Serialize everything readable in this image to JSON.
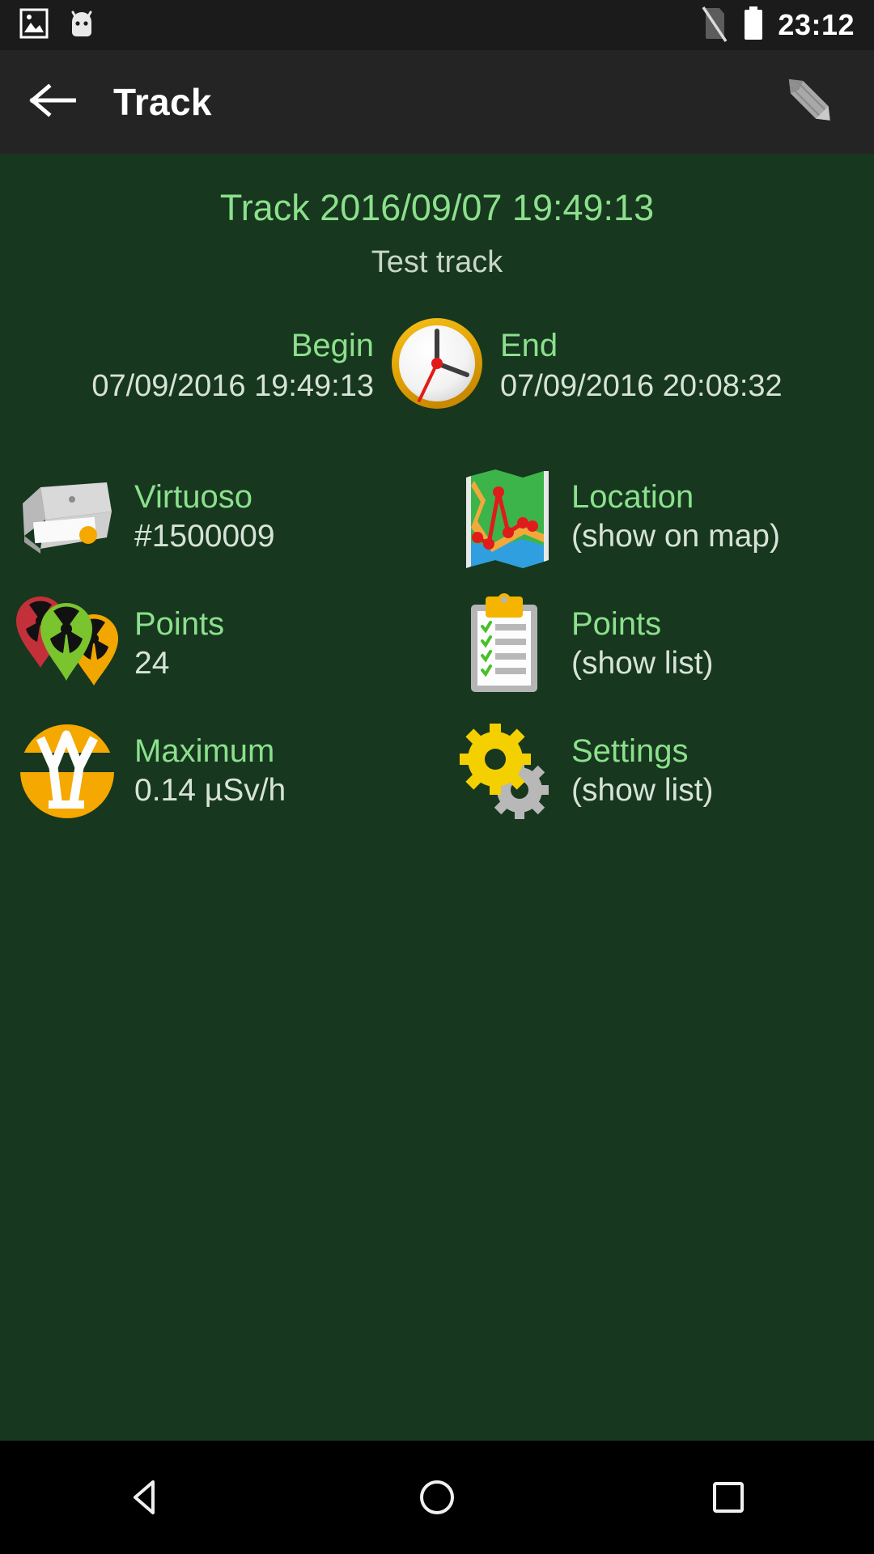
{
  "statusbar": {
    "time": "23:12",
    "icons": [
      "image-icon",
      "android-head-icon",
      "sim-off-icon",
      "battery-full-icon"
    ]
  },
  "actionbar": {
    "back_icon": "arrow-back-icon",
    "title": "Track",
    "edit_icon": "pencil-edit-icon"
  },
  "track": {
    "title": "Track 2016/09/07 19:49:13",
    "subtitle": "Test track",
    "begin_label": "Begin",
    "begin_value": "07/09/2016 19:49:13",
    "end_label": "End",
    "end_value": "07/09/2016 20:08:32",
    "clock_icon": "analog-clock-icon"
  },
  "rows": [
    {
      "left": {
        "icon": "device-box-icon",
        "label": "Virtuoso",
        "value": "#1500009"
      },
      "right": {
        "icon": "folded-map-icon",
        "label": "Location",
        "value": "(show on map)"
      }
    },
    {
      "left": {
        "icon": "radiation-markers-icon",
        "label": "Points",
        "value": "24"
      },
      "right": {
        "icon": "clipboard-list-icon",
        "label": "Points",
        "value": "(show list)"
      }
    },
    {
      "left": {
        "icon": "gamma-dose-icon",
        "label": "Maximum",
        "value": "0.14 µSv/h"
      },
      "right": {
        "icon": "gears-settings-icon",
        "label": "Settings",
        "value": "(show list)"
      }
    }
  ],
  "navbar": {
    "back": "nav-back-triangle-icon",
    "home": "nav-home-circle-icon",
    "recents": "nav-recents-square-icon"
  },
  "colors": {
    "background": "#17371f",
    "statusbar": "#1b1b1b",
    "actionbar": "#242424",
    "label_green": "#8ce08c",
    "value_grey": "#d7e3d7",
    "accent_amber": "#f5a800"
  }
}
